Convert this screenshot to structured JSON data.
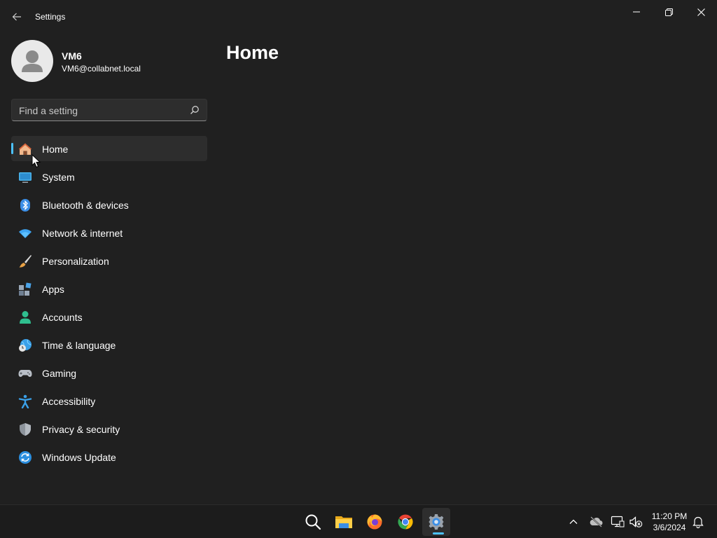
{
  "window": {
    "title": "Settings",
    "icons": {
      "back": "back-arrow-icon",
      "minimize": "minimize-icon",
      "maximize": "restore-icon",
      "close": "close-icon"
    }
  },
  "profile": {
    "name": "VM6",
    "email": "VM6@collabnet.local",
    "avatar_icon": "user-avatar-icon"
  },
  "search": {
    "placeholder": "Find a setting",
    "value": "",
    "icon": "search-icon"
  },
  "nav": {
    "selected": "Home",
    "items": [
      {
        "label": "Home",
        "icon": "home-icon"
      },
      {
        "label": "System",
        "icon": "monitor-icon"
      },
      {
        "label": "Bluetooth & devices",
        "icon": "bluetooth-icon"
      },
      {
        "label": "Network & internet",
        "icon": "wifi-icon"
      },
      {
        "label": "Personalization",
        "icon": "paintbrush-icon"
      },
      {
        "label": "Apps",
        "icon": "apps-icon"
      },
      {
        "label": "Accounts",
        "icon": "person-icon"
      },
      {
        "label": "Time & language",
        "icon": "globe-clock-icon"
      },
      {
        "label": "Gaming",
        "icon": "gamepad-icon"
      },
      {
        "label": "Accessibility",
        "icon": "accessibility-icon"
      },
      {
        "label": "Privacy & security",
        "icon": "shield-icon"
      },
      {
        "label": "Windows Update",
        "icon": "update-icon"
      }
    ]
  },
  "main": {
    "title": "Home"
  },
  "taskbar": {
    "apps": [
      {
        "name": "Search",
        "icon": "search-icon"
      },
      {
        "name": "File Explorer",
        "icon": "folder-icon"
      },
      {
        "name": "Firefox",
        "icon": "firefox-icon"
      },
      {
        "name": "Chrome",
        "icon": "chrome-icon"
      },
      {
        "name": "Settings",
        "icon": "gear-icon",
        "active": true
      }
    ],
    "tray": {
      "icons": [
        "chevron-up-icon",
        "cloud-offline-icon",
        "network-icon",
        "volume-muted-icon"
      ],
      "time": "11:20 PM",
      "date": "3/6/2024",
      "notification_icon": "bell-icon"
    }
  },
  "colors": {
    "background": "#202020",
    "accent": "#4cc2ff",
    "taskbar": "#1c1c1c",
    "selected_item": "#2d2d2d"
  }
}
